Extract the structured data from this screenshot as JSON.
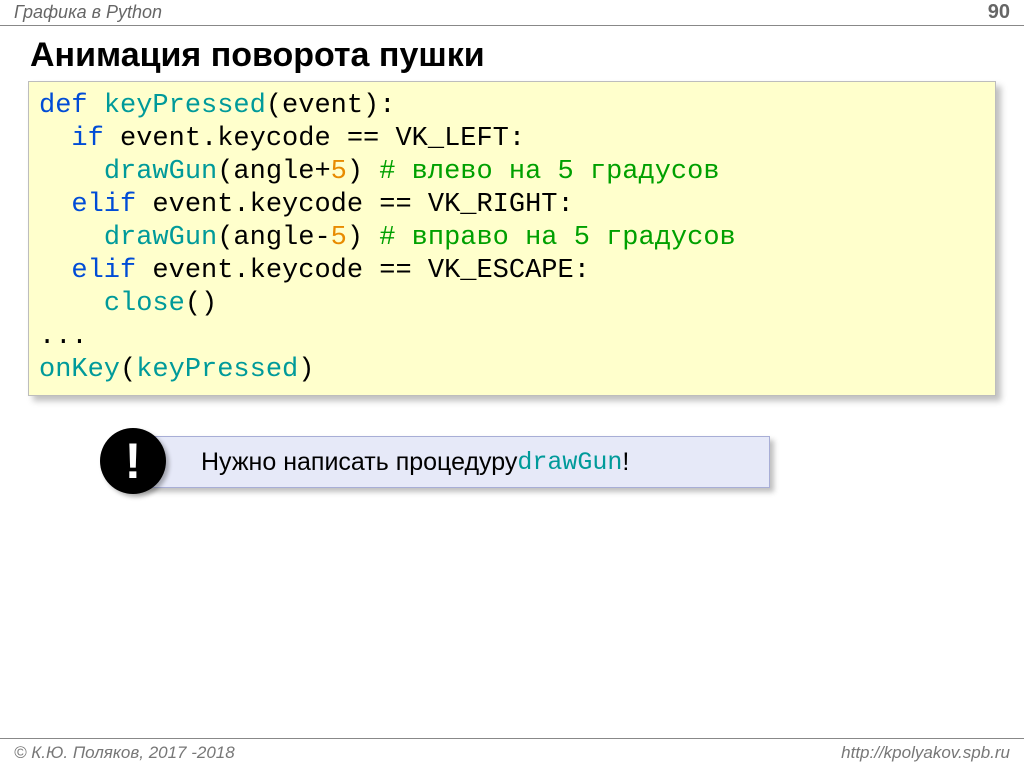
{
  "header": {
    "topic": "Графика в Python",
    "page": "90"
  },
  "title": "Анимация поворота пушки",
  "code": {
    "l1a": "def",
    "l1b": "keyPressed",
    "l1c": "(event):",
    "l2a": "if",
    "l2b": " event.keycode == VK_LEFT:",
    "l3a": "drawGun",
    "l3b": "(angle+",
    "l3c": "5",
    "l3d": ") ",
    "l3e": "# влево на 5 градусов",
    "l4a": "elif",
    "l4b": " event.keycode == VK_RIGHT:",
    "l5a": "drawGun",
    "l5b": "(angle-",
    "l5c": "5",
    "l5d": ") ",
    "l5e": "# вправо на 5 градусов",
    "l6a": "elif",
    "l6b": " event.keycode == VK_ESCAPE:",
    "l7a": "close",
    "l7b": "()",
    "l8": "...",
    "l9a": "onKey",
    "l9b": "(",
    "l9c": "keyPressed",
    "l9d": ")"
  },
  "note": {
    "excl": "!",
    "text_before": "Нужно написать процедуру ",
    "proc": "drawGun",
    "text_after": "!"
  },
  "footer": {
    "left": "© К.Ю. Поляков, 2017 -2018",
    "right": "http://kpolyakov.spb.ru"
  }
}
